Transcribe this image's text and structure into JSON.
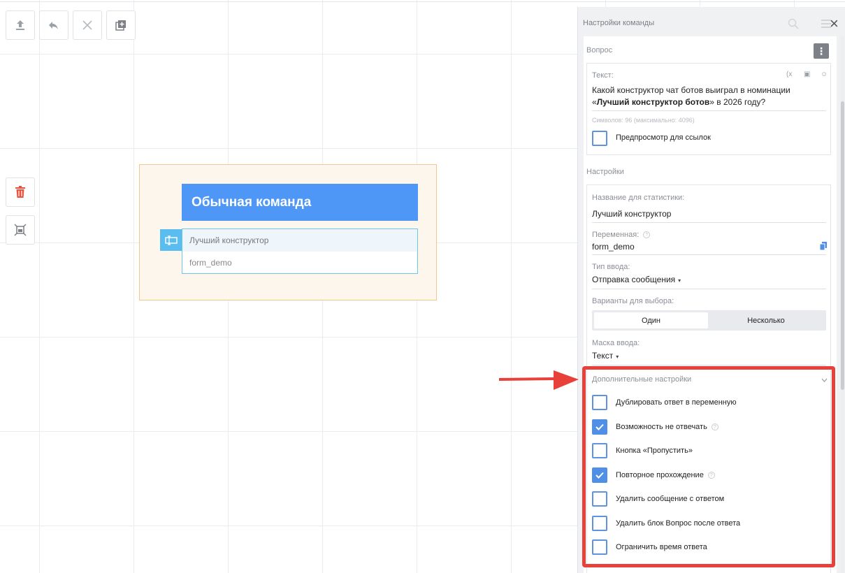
{
  "toolbar": {
    "buttons": [
      {
        "icon": "upload-icon"
      },
      {
        "icon": "undo-icon"
      },
      {
        "icon": "close-icon"
      },
      {
        "icon": "add-copy-icon"
      }
    ]
  },
  "side_tools": {
    "delete_icon": "trash-icon",
    "fit_icon": "fit-screen-icon",
    "delete_color": "#e8543f"
  },
  "block": {
    "title": "Обычная команда",
    "row_label": "Лучший конструктор",
    "row_variable": "form_demo",
    "header_color": "#4f97f7",
    "tag_icon": "input-field-icon"
  },
  "panel": {
    "title": "Настройки команды",
    "question": {
      "section_label": "Вопрос",
      "text_label": "Текст:",
      "text_before": "Какой конструктор чат ботов выиграл в номинации «",
      "text_bold": "Лучший конструктор ботов",
      "text_after": "» в 2026 году?",
      "counter": "Символов: 96 (максимально: 4096)",
      "link_preview_label": "Предпросмотр для ссылок",
      "link_preview_checked": false
    },
    "settings": {
      "section_label": "Настройки",
      "stats_name_label": "Название для статистики:",
      "stats_name_value": "Лучший конструктор",
      "variable_label": "Переменная:",
      "variable_value": "form_demo",
      "input_type_label": "Тип ввода:",
      "input_type_value": "Отправка сообщения",
      "choice_label": "Варианты для выбора:",
      "choice_options": [
        "Один",
        "Несколько"
      ],
      "choice_selected": "Один",
      "mask_label": "Маска ввода:",
      "mask_value": "Текст"
    },
    "advanced": {
      "section_label": "Дополнительные настройки",
      "options": [
        {
          "label": "Дублировать ответ в переменную",
          "checked": false,
          "help": false
        },
        {
          "label": "Возможность не отвечать",
          "checked": true,
          "help": true
        },
        {
          "label": "Кнопка «Пропустить»",
          "checked": false,
          "help": false
        },
        {
          "label": "Повторное прохождение",
          "checked": true,
          "help": true
        },
        {
          "label": "Удалить сообщение с ответом",
          "checked": false,
          "help": false
        },
        {
          "label": "Удалить блок Вопрос после ответа",
          "checked": false,
          "help": false
        },
        {
          "label": "Ограничить время ответа",
          "checked": false,
          "help": false
        }
      ]
    }
  },
  "annotation": {
    "color": "#e8413a"
  }
}
